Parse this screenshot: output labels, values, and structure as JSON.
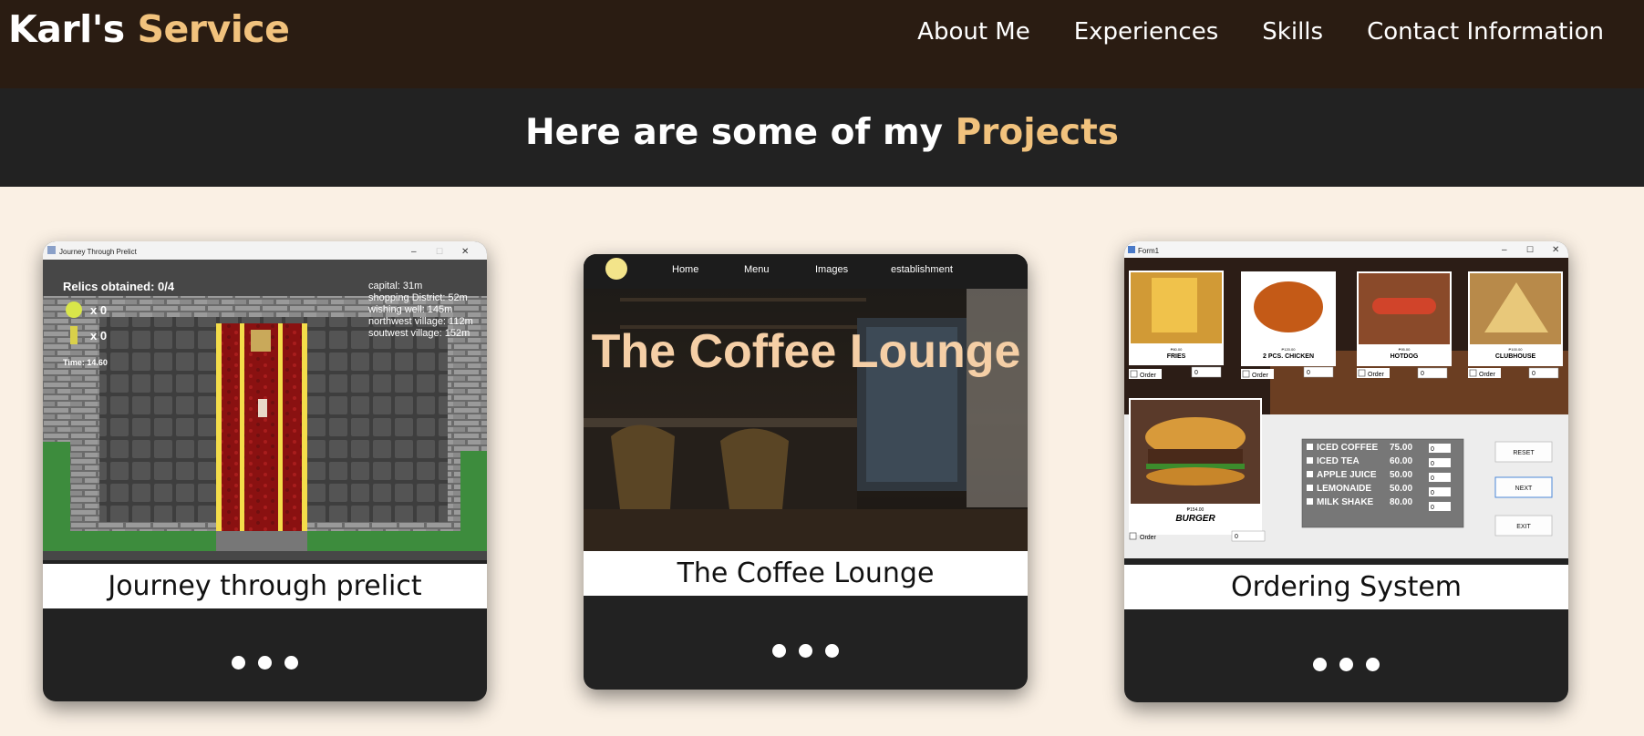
{
  "header": {
    "logo_main": "Karl's",
    "logo_accent": "Service",
    "nav": [
      "About Me",
      "Experiences",
      "Skills",
      "Contact Information"
    ]
  },
  "section": {
    "title_main": "Here are some of my",
    "title_accent": "Projects"
  },
  "projects": [
    {
      "caption": "Journey through prelict",
      "window_title": "Journey Through Prelict",
      "relics": "Relics obtained: 0/4",
      "count_1": "x 0",
      "count_2": "x 0",
      "time": "Time: 14.60",
      "distances": [
        "capital: 31m",
        "shopping District: 52m",
        "wishing well: 145m",
        "northwest village: 112m",
        "soutwest village: 152m"
      ]
    },
    {
      "caption": "The Coffee Lounge",
      "nav": [
        "Home",
        "Menu",
        "Images",
        "establishment"
      ],
      "hero_title": "The Coffee Lounge"
    },
    {
      "caption": "Ordering System",
      "window_title": "Form1",
      "items": [
        {
          "price": "₱80.00",
          "name": "FRIES"
        },
        {
          "price": "₱120.00",
          "name": "2 PCS. CHICKEN"
        },
        {
          "price": "₱95.00",
          "name": "HOTDOG"
        },
        {
          "price": "₱100.00",
          "name": "CLUBHOUSE"
        }
      ],
      "order_label": "Order",
      "qty_value": "0",
      "burger": {
        "price": "₱154.00",
        "name": "BURGER"
      },
      "drinks": [
        {
          "name": "ICED COFFEE",
          "price": "75.00"
        },
        {
          "name": "ICED TEA",
          "price": "60.00"
        },
        {
          "name": "APPLE JUICE",
          "price": "50.00"
        },
        {
          "name": "LEMONAIDE",
          "price": "50.00"
        },
        {
          "name": "MILK SHAKE",
          "price": "80.00"
        }
      ],
      "buttons": [
        "RESET",
        "NEXT",
        "EXIT"
      ]
    }
  ],
  "colors": {
    "header_bg": "#2a1c12",
    "accent": "#f1c27d",
    "title_bar_bg": "#222222",
    "page_bg": "#faf0e4"
  }
}
